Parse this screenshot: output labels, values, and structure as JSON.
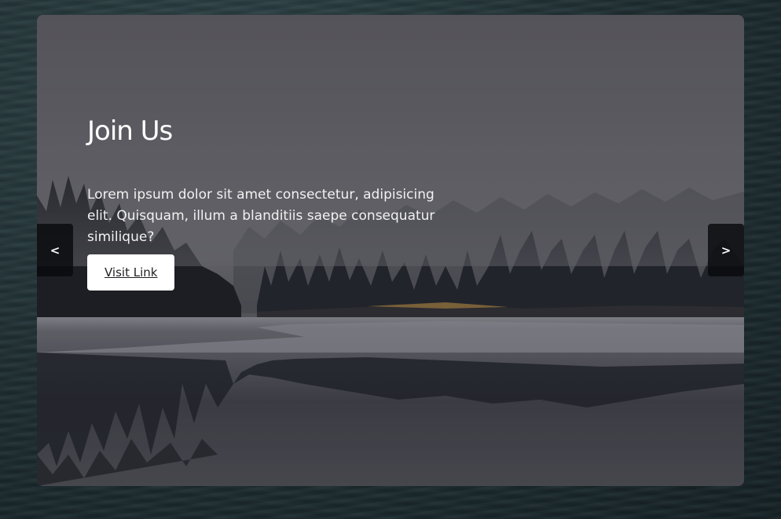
{
  "slide": {
    "title": "Join Us",
    "text": "Lorem ipsum dolor sit amet consectetur, adipisicing elit. Quisquam, illum a blanditiis saepe consequatur similique?",
    "button_label": "Visit Link"
  },
  "nav": {
    "prev_label": "<",
    "next_label": ">"
  },
  "icons": {
    "background": "misty-lake-forest-image",
    "page_background": "dark-water-texture"
  }
}
